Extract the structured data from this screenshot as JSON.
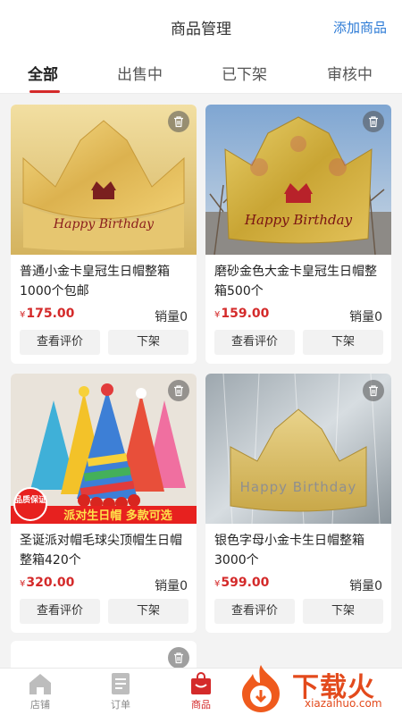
{
  "header": {
    "title": "商品管理",
    "add_label": "添加商品"
  },
  "tabs": [
    {
      "label": "全部",
      "active": true
    },
    {
      "label": "出售中",
      "active": false
    },
    {
      "label": "已下架",
      "active": false
    },
    {
      "label": "审核中",
      "active": false
    }
  ],
  "currency_symbol": "¥",
  "products": [
    {
      "name": "普通小金卡皇冠生日帽整箱1000个包邮",
      "price": "175.00",
      "sales": "销量0",
      "review_label": "查看评价",
      "offshelf_label": "下架",
      "image_text": "Happy Birthday"
    },
    {
      "name": "磨砂金色大金卡皇冠生日帽整箱500个",
      "price": "159.00",
      "sales": "销量0",
      "review_label": "查看评价",
      "offshelf_label": "下架",
      "image_text": "Happy Birthday"
    },
    {
      "name": "圣诞派对帽毛球尖顶帽生日帽整箱420个",
      "price": "320.00",
      "sales": "销量0",
      "review_label": "查看评价",
      "offshelf_label": "下架",
      "image_text": "派对生日帽 多款可选",
      "badge": "品质保证"
    },
    {
      "name": "银色字母小金卡生日帽整箱3000个",
      "price": "599.00",
      "sales": "销量0",
      "review_label": "查看评价",
      "offshelf_label": "下架",
      "image_text": "Happy Birthday"
    }
  ],
  "nav": [
    {
      "label": "店铺",
      "icon": "store-icon",
      "active": false
    },
    {
      "label": "订单",
      "icon": "order-icon",
      "active": false
    },
    {
      "label": "商品",
      "icon": "goods-bag-icon",
      "active": true
    }
  ],
  "watermark": {
    "text": "下载火",
    "url": "xiazaihuo.com"
  },
  "colors": {
    "accent": "#d42a2a",
    "link": "#2d7bd6",
    "background": "#f3f3f3"
  }
}
